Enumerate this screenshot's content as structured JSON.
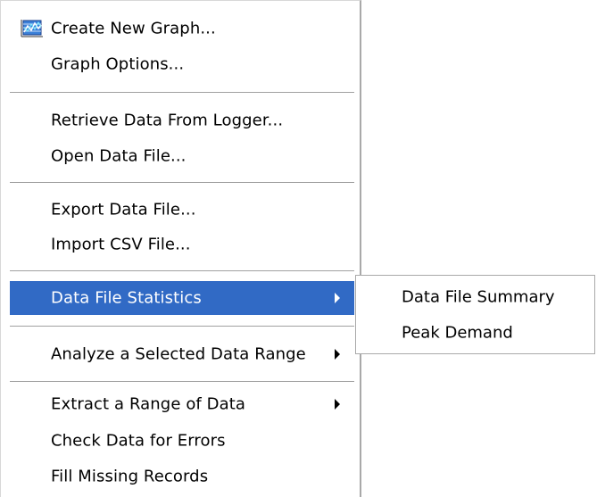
{
  "menu": {
    "items": [
      {
        "label": "Create New Graph...",
        "icon": "graph-icon"
      },
      {
        "label": "Graph Options..."
      },
      {
        "label": "Retrieve Data From Logger..."
      },
      {
        "label": "Open Data File..."
      },
      {
        "label": "Export Data File..."
      },
      {
        "label": "Import CSV File..."
      },
      {
        "label": "Data File Statistics",
        "submenu": true,
        "highlighted": true
      },
      {
        "label": "Analyze a Selected Data Range",
        "submenu": true
      },
      {
        "label": "Extract a Range of Data",
        "submenu": true
      },
      {
        "label": "Check Data for Errors"
      },
      {
        "label": "Fill Missing Records"
      }
    ]
  },
  "submenu": {
    "items": [
      {
        "label": "Data File Summary"
      },
      {
        "label": "Peak Demand"
      }
    ]
  },
  "colors": {
    "highlight": "#316ac5",
    "separator": "#a0a0a0",
    "border": "#a9a9a9"
  }
}
